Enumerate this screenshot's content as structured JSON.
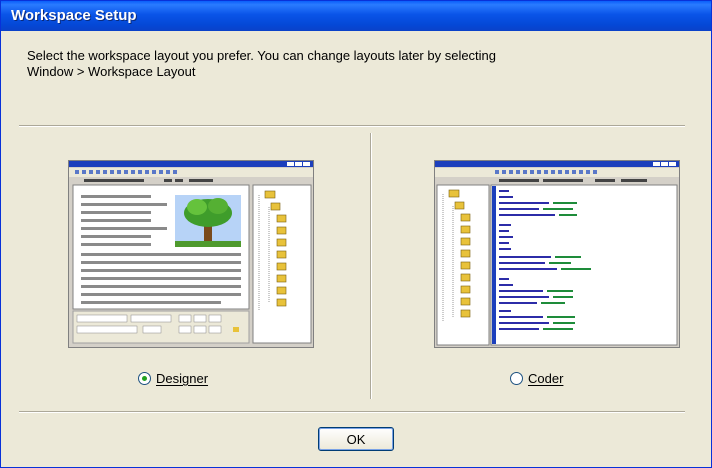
{
  "window": {
    "title": "Workspace Setup"
  },
  "prompt": {
    "line1": "Select the workspace layout you prefer. You can change layouts later by selecting",
    "line2": "Window > Workspace Layout"
  },
  "options": [
    {
      "label": "Designer",
      "selected": true,
      "image": "designer-workspace-preview"
    },
    {
      "label": "Coder",
      "selected": false,
      "image": "coder-workspace-preview"
    }
  ],
  "buttons": {
    "ok": "OK"
  },
  "colors": {
    "titlebar": "#0a54e8",
    "dialog_bg": "#ece9d8",
    "radio_dot": "#21a121",
    "preview_titlebar": "#1c3fbc"
  }
}
